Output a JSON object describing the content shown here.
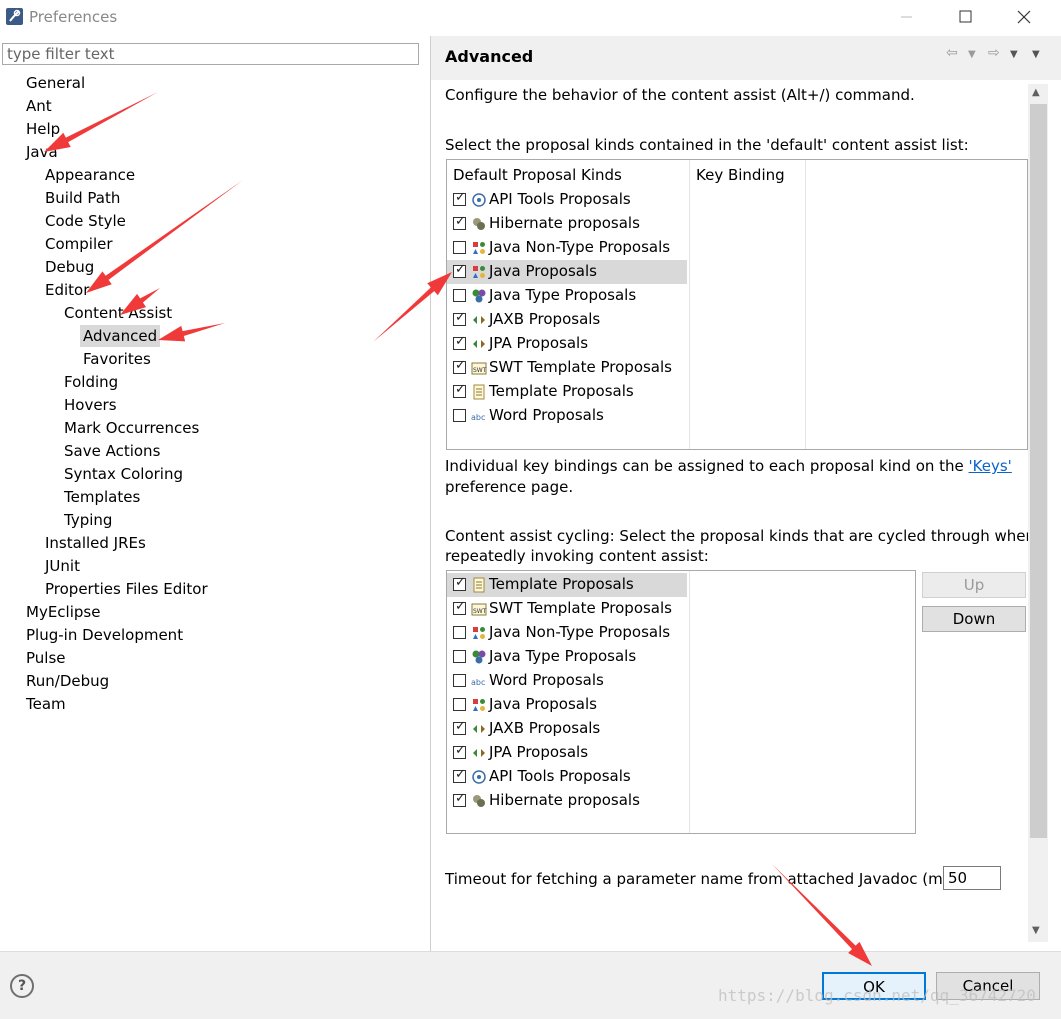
{
  "window": {
    "title": "Preferences",
    "app_icon": "eclipse-logo-icon",
    "controls": [
      "minimize-icon",
      "maximize-icon",
      "close-icon"
    ]
  },
  "filter": {
    "placeholder": "type filter text",
    "value": ""
  },
  "tree": [
    {
      "label": "General",
      "level": 0
    },
    {
      "label": "Ant",
      "level": 0
    },
    {
      "label": "Help",
      "level": 0
    },
    {
      "label": "Java",
      "level": 0
    },
    {
      "label": "Appearance",
      "level": 1
    },
    {
      "label": "Build Path",
      "level": 1
    },
    {
      "label": "Code Style",
      "level": 1
    },
    {
      "label": "Compiler",
      "level": 1
    },
    {
      "label": "Debug",
      "level": 1
    },
    {
      "label": "Editor",
      "level": 1
    },
    {
      "label": "Content Assist",
      "level": 2
    },
    {
      "label": "Advanced",
      "level": 3,
      "selected": true
    },
    {
      "label": "Favorites",
      "level": 3
    },
    {
      "label": "Folding",
      "level": 2
    },
    {
      "label": "Hovers",
      "level": 2
    },
    {
      "label": "Mark Occurrences",
      "level": 2
    },
    {
      "label": "Save Actions",
      "level": 2
    },
    {
      "label": "Syntax Coloring",
      "level": 2
    },
    {
      "label": "Templates",
      "level": 2
    },
    {
      "label": "Typing",
      "level": 2
    },
    {
      "label": "Installed JREs",
      "level": 1
    },
    {
      "label": "JUnit",
      "level": 1
    },
    {
      "label": "Properties Files Editor",
      "level": 1
    },
    {
      "label": "MyEclipse",
      "level": 0
    },
    {
      "label": "Plug-in Development",
      "level": 0
    },
    {
      "label": "Pulse",
      "level": 0
    },
    {
      "label": "Run/Debug",
      "level": 0
    },
    {
      "label": "Team",
      "level": 0
    }
  ],
  "page": {
    "title": "Advanced",
    "nav_icons": [
      "back-arrow-icon",
      "back-menu-icon",
      "forward-arrow-icon",
      "forward-menu-icon",
      "view-menu-icon"
    ],
    "description": "Configure the behavior of the content assist (Alt+/) command.",
    "select_label": "Select the proposal kinds contained in the 'default' content assist list:",
    "table_headers": [
      "Default Proposal Kinds",
      "Key Binding"
    ],
    "default_kinds": [
      {
        "label": "API Tools Proposals",
        "checked": true,
        "icon": "api-tools-icon"
      },
      {
        "label": "Hibernate proposals",
        "checked": true,
        "icon": "hibernate-icon"
      },
      {
        "label": "Java Non-Type Proposals",
        "checked": false,
        "icon": "java-nontype-icon"
      },
      {
        "label": "Java Proposals",
        "checked": true,
        "icon": "java-proposals-icon",
        "selected": true
      },
      {
        "label": "Java Type Proposals",
        "checked": false,
        "icon": "java-type-icon"
      },
      {
        "label": "JAXB Proposals",
        "checked": true,
        "icon": "jaxb-icon"
      },
      {
        "label": "JPA Proposals",
        "checked": true,
        "icon": "jpa-icon"
      },
      {
        "label": "SWT Template Proposals",
        "checked": true,
        "icon": "swt-template-icon"
      },
      {
        "label": "Template Proposals",
        "checked": true,
        "icon": "template-icon"
      },
      {
        "label": "Word Proposals",
        "checked": false,
        "icon": "word-icon"
      }
    ],
    "keys_text_before": "Individual key bindings can be assigned to each proposal kind on the ",
    "keys_link": "'Keys'",
    "keys_text_after": "preference page.",
    "cycling_line1": "Content assist cycling: Select the proposal kinds that are cycled through when",
    "cycling_line2": "repeatedly invoking content assist:",
    "cycling_kinds": [
      {
        "label": "Template Proposals",
        "checked": true,
        "icon": "template-icon",
        "selected": true
      },
      {
        "label": "SWT Template Proposals",
        "checked": true,
        "icon": "swt-template-icon"
      },
      {
        "label": "Java Non-Type Proposals",
        "checked": false,
        "icon": "java-nontype-icon"
      },
      {
        "label": "Java Type Proposals",
        "checked": false,
        "icon": "java-type-icon"
      },
      {
        "label": "Word Proposals",
        "checked": false,
        "icon": "word-icon"
      },
      {
        "label": "Java Proposals",
        "checked": false,
        "icon": "java-proposals-icon"
      },
      {
        "label": "JAXB Proposals",
        "checked": true,
        "icon": "jaxb-icon"
      },
      {
        "label": "JPA Proposals",
        "checked": true,
        "icon": "jpa-icon"
      },
      {
        "label": "API Tools Proposals",
        "checked": true,
        "icon": "api-tools-icon"
      },
      {
        "label": "Hibernate proposals",
        "checked": true,
        "icon": "hibernate-icon"
      }
    ],
    "up_label": "Up",
    "down_label": "Down",
    "timeout_label": "Timeout for fetching a parameter name from attached Javadoc (ms):",
    "timeout_value": "50"
  },
  "footer": {
    "help_icon": "help-icon",
    "help_glyph": "?",
    "ok_label": "OK",
    "cancel_label": "Cancel"
  },
  "watermark": "https://blog.csdn.net/qq_36742720",
  "colors": {
    "annotation_arrow": "#f03a3a",
    "selection": "#d9d9d9",
    "link": "#0a64c8",
    "default_button_border": "#0078d7"
  }
}
